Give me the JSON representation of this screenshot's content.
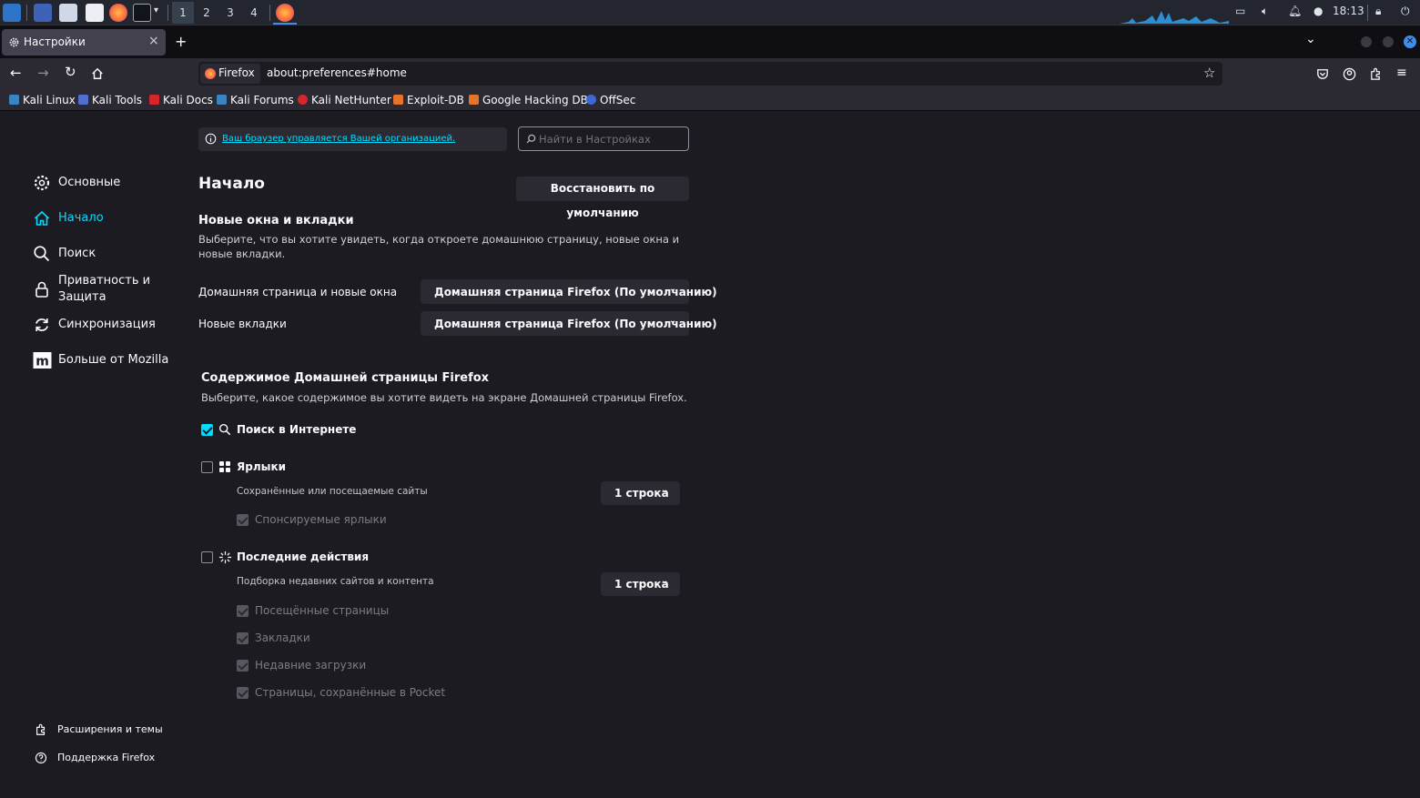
{
  "taskbar": {
    "workspaces": [
      "1",
      "2",
      "3",
      "4"
    ],
    "clock": "18:13"
  },
  "tab": {
    "title": "Настройки",
    "close": "×",
    "new_tab": "+"
  },
  "navbar": {
    "identity_label": "Firefox",
    "url": "about:preferences#home"
  },
  "bookmarks": [
    {
      "label": "Kali Linux",
      "color": "#3a84c4"
    },
    {
      "label": "Kali Tools",
      "color": "#4f6fd1"
    },
    {
      "label": "Kali Docs",
      "color": "#d7262b"
    },
    {
      "label": "Kali Forums",
      "color": "#3a84c4"
    },
    {
      "label": "Kali NetHunter",
      "color": "#d7262b"
    },
    {
      "label": "Exploit-DB",
      "color": "#e8732a"
    },
    {
      "label": "Google Hacking DB",
      "color": "#e8732a"
    },
    {
      "label": "OffSec",
      "color": "#3f67d6"
    }
  ],
  "policy_notice": "Ваш браузер управляется Вашей организацией.",
  "search": {
    "placeholder": "Найти в Настройках"
  },
  "sidebar": {
    "items": [
      {
        "label": "Основные",
        "icon": "gear-icon"
      },
      {
        "label": "Начало",
        "icon": "home-icon"
      },
      {
        "label": "Поиск",
        "icon": "search-icon"
      },
      {
        "label": "Приватность и Защита",
        "icon": "lock-icon"
      },
      {
        "label": "Синхронизация",
        "icon": "sync-icon"
      },
      {
        "label": "Больше от Mozilla",
        "icon": "mozilla-icon"
      }
    ],
    "footer": [
      {
        "label": "Расширения и темы",
        "icon": "extensions-icon"
      },
      {
        "label": "Поддержка Firefox",
        "icon": "help-icon"
      }
    ]
  },
  "main": {
    "title": "Начало",
    "restore_button": "Восстановить по умолчанию",
    "new_windows": {
      "heading": "Новые окна и вкладки",
      "description": "Выберите, что вы хотите увидеть, когда откроете домашнюю страницу, новые окна и новые вкладки.",
      "homepage_label": "Домашняя страница и новые окна",
      "homepage_value": "Домашняя страница Firefox (По умолчанию)",
      "newtabs_label": "Новые вкладки",
      "newtabs_value": "Домашняя страница Firefox (По умолчанию)"
    },
    "home_content": {
      "heading": "Содержимое Домашней страницы Firefox",
      "description": "Выберите, какое содержимое вы хотите видеть на экране Домашней страницы Firefox.",
      "web_search": {
        "label": "Поиск в Интернете",
        "checked": true
      },
      "shortcuts": {
        "label": "Ярлыки",
        "checked": false,
        "sub": "Сохранённые или посещаемые сайты",
        "rows": "1 строка",
        "sponsored": "Спонсируемые ярлыки"
      },
      "recent": {
        "label": "Последние действия",
        "checked": false,
        "sub": "Подборка недавних сайтов и контента",
        "rows": "1 строка",
        "options": [
          "Посещённые страницы",
          "Закладки",
          "Недавние загрузки",
          "Страницы, сохранённые в Pocket"
        ]
      }
    }
  }
}
